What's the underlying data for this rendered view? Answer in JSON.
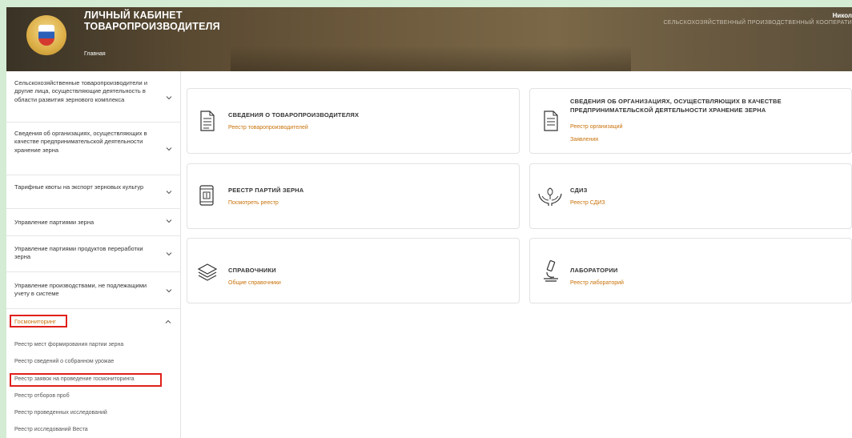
{
  "header": {
    "title_line1": "ЛИЧНЫЙ КАБИНЕТ",
    "title_line2": "ТОВАРОПРОИЗВОДИТЕЛЯ",
    "breadcrumb": "Главная",
    "user_name": "Никол",
    "org_name": "СЕЛЬСКОХОЗЯЙСТВЕННЫЙ ПРОИЗВОДСТВЕННЫЙ КООПЕРАТИ"
  },
  "sidebar": {
    "items": [
      {
        "label": "Сельскохозяйственные товаропроизводители и другие лица, осуществляющие деятельность в области развития зернового комплекса"
      },
      {
        "label": "Сведения об организациях, осуществляющих в качестве предпринимательской деятельности хранение зерна"
      },
      {
        "label": "Тарифные квоты на экспорт зерновых культур"
      },
      {
        "label": "Управление партиями зерна"
      },
      {
        "label": "Управление партиями продуктов переработки зерна"
      },
      {
        "label": "Управление производствами, не подлежащими учету в системе"
      }
    ],
    "gosmonitoring": {
      "label": "Госмониторинг",
      "subitems": [
        "Реестр мест формирования партии зерна",
        "Реестр сведений о собранном урожае",
        "Реестр заявок на проведение госмониторинга",
        "Реестр отборов проб",
        "Реестр проведенных исследований",
        "Реестр исследований Веста"
      ]
    }
  },
  "cards": {
    "producers": {
      "title": "СВЕДЕНИЯ О ТОВАРОПРОИЗВОДИТЕЛЯХ",
      "links": [
        "Реестр товаропроизводителей"
      ]
    },
    "storage": {
      "title_line1": "СВЕДЕНИЯ ОБ ОРГАНИЗАЦИЯХ, ОСУЩЕСТВЛЯЮЩИХ В КАЧЕСТВЕ",
      "title_line2": "ПРЕДПРИНИМАТЕЛЬСКОЙ ДЕЯТЕЛЬНОСТИ ХРАНЕНИЕ ЗЕРНА",
      "links": [
        "Реестр организаций",
        "Заявления"
      ]
    },
    "batches": {
      "title": "РЕЕСТР ПАРТИЙ ЗЕРНА",
      "links": [
        "Посмотреть реестр"
      ]
    },
    "sdiz": {
      "title": "СДИЗ",
      "links": [
        "Реестр СДИЗ"
      ]
    },
    "directories": {
      "title": "СПРАВОЧНИКИ",
      "links": [
        "Общие справочники"
      ]
    },
    "labs": {
      "title": "ЛАБОРАТОРИИ",
      "links": [
        "Реестр лабораторий"
      ]
    }
  },
  "colors": {
    "accent": "#c8720a",
    "highlight": "#e0201b",
    "frame": "#d4ecd4"
  }
}
